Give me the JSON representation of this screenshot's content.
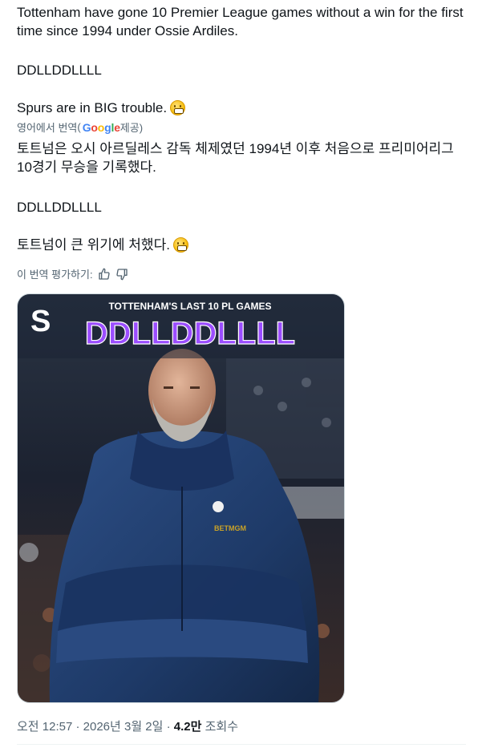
{
  "tweet": {
    "original_line1": "Tottenham have gone 10 Premier League games without a win for the first time since 1994 under Ossie Ardiles.",
    "original_line2": "DDLLDDLLLL",
    "original_line3": "Spurs are in BIG trouble.",
    "emoji_icon": "grimacing-face-emoji"
  },
  "translation": {
    "translated_from": "영어에서 번역",
    "paren_open": "(",
    "google": "Google",
    "provided": " 제공)",
    "kr_line1": "토트넘은 오시 아르딜레스 감독 체제였던 1994년 이후 처음으로 프리미어리그 10경기 무승을 기록했다.",
    "kr_line2": "DDLLDDLLLL",
    "kr_line3": "토트넘이 큰 위기에 처했다.",
    "rate_label": "이 번역 평가하기:",
    "thumb_up_icon": "thumbs-up-icon",
    "thumb_down_icon": "thumbs-down-icon"
  },
  "media": {
    "headline": "TOTTENHAM'S LAST 10 PL GAMES",
    "big_text": "DDLLDDLLLL",
    "logo_letter": "S",
    "sponsor": "BETMGM",
    "accent_color": "#8a2be2",
    "bg_color": "#1b2535",
    "jacket_color": "#1f3a6b"
  },
  "meta": {
    "time": "오전 12:57",
    "sep": " · ",
    "date": "2026년 3월 2일",
    "views_count": "4.2만",
    "views_label": " 조회수"
  }
}
